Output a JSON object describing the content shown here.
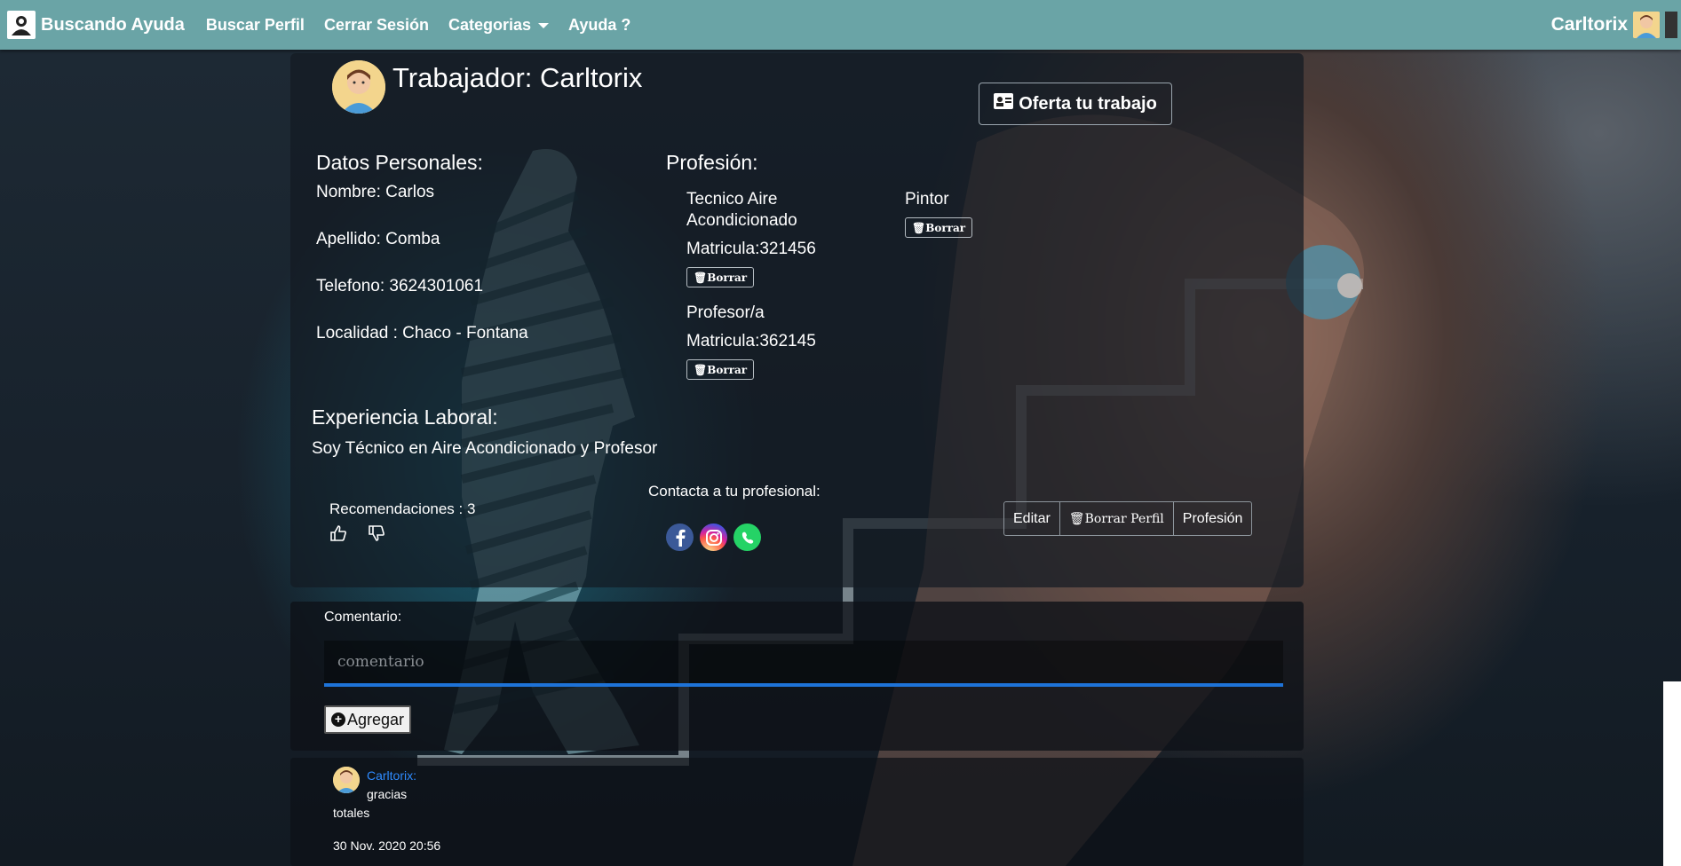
{
  "navbar": {
    "brand": "Buscando Ayuda",
    "links": [
      "Buscar Perfil",
      "Cerrar Sesión",
      "Categorias",
      "Ayuda ?"
    ],
    "user": "Carltorix"
  },
  "profile": {
    "title": "Trabajador: Carltorix",
    "offer_button": "Oferta tu trabajo",
    "personal": {
      "heading": "Datos Personales:",
      "nombre": "Nombre: Carlos",
      "apellido": "Apellido: Comba",
      "telefono": "Telefono: 3624301061",
      "localidad": "Localidad : Chaco - Fontana"
    },
    "profesion": {
      "heading": "Profesión:",
      "items": [
        {
          "name_line1": "Tecnico Aire",
          "name_line2": "Acondicionado",
          "matricula": "Matricula:321456",
          "delete": "Borrar"
        },
        {
          "name_line1": "Profesor/a",
          "matricula": "Matricula:362145",
          "delete": "Borrar"
        },
        {
          "name_line1": "Pintor",
          "delete": "Borrar"
        }
      ]
    },
    "experiencia": {
      "heading": "Experiencia Laboral:",
      "text": "Soy Técnico en Aire Acondicionado y Profesor"
    },
    "recomendaciones": "Recomendaciones : 3",
    "contacto": "Contacta a tu profesional:",
    "actions": [
      "Editar",
      "Borrar Perfil",
      "Profesión"
    ]
  },
  "comment_form": {
    "label": "Comentario:",
    "placeholder": "comentario",
    "submit": "Agregar"
  },
  "comments": [
    {
      "user": "Carltorix:",
      "text_line1": "gracias",
      "text_line2": "totales",
      "date": "30 Nov. 2020 20:56"
    }
  ],
  "icons": {
    "brand": "user-search-icon",
    "offer": "id-card-icon",
    "delete": "trash-icon",
    "like": "thumbs-up-icon",
    "dislike": "thumbs-down-icon",
    "socials": [
      "facebook-icon",
      "instagram-icon",
      "whatsapp-icon"
    ],
    "add": "plus-circle-icon"
  },
  "colors": {
    "navbar": "#6aa4a6",
    "input_underline": "#1e73d8",
    "comment_user": "#2e8bff"
  }
}
